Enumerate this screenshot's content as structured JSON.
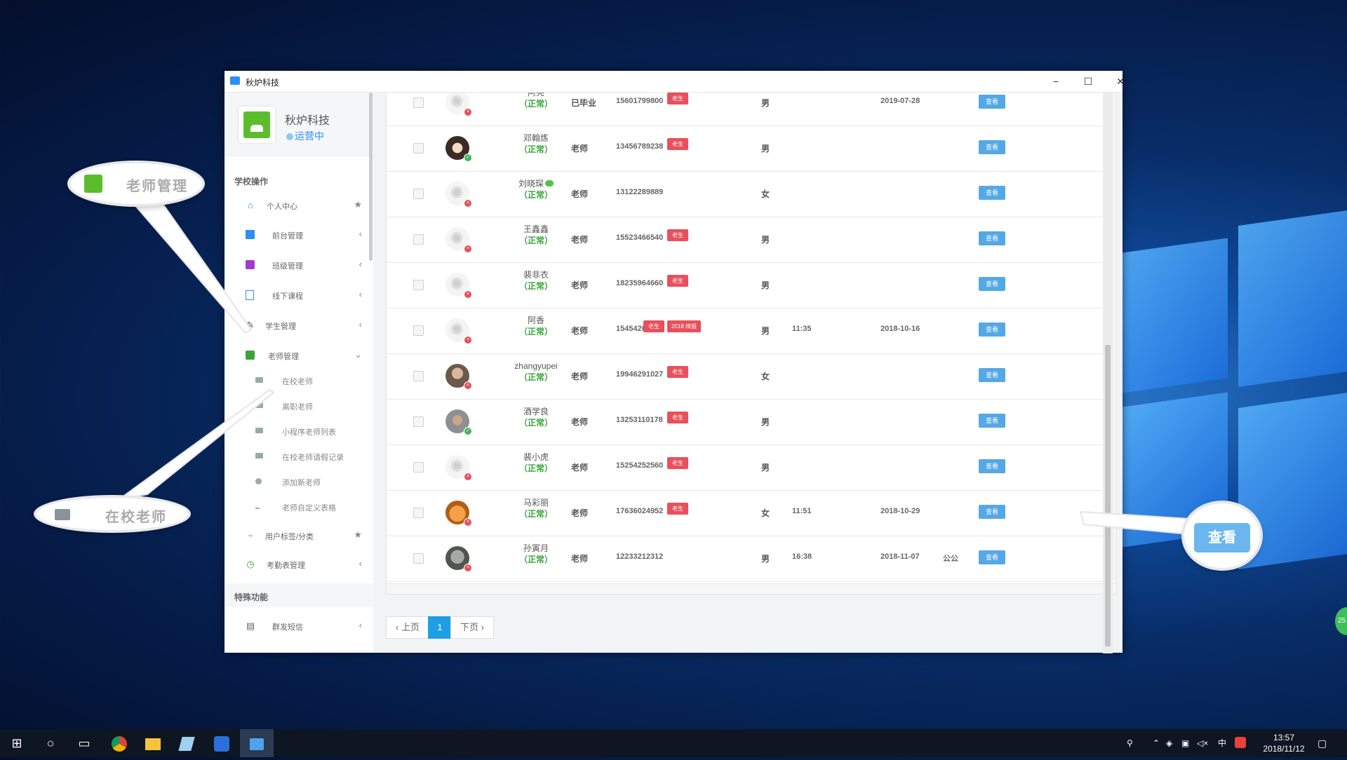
{
  "window": {
    "title": "秋炉科技"
  },
  "brand": {
    "name": "秋炉科技",
    "status": "运营中"
  },
  "sidebar": {
    "section1": "学校操作",
    "items": [
      {
        "label": "个人中心",
        "icon": "home-icon",
        "right": "★"
      },
      {
        "label": "前台管理",
        "icon": "grid-icon",
        "right": "‹"
      },
      {
        "label": "班级管理",
        "icon": "class-icon",
        "right": "‹"
      },
      {
        "label": "线下课程",
        "icon": "doc-icon",
        "right": "‹"
      },
      {
        "label": "学生管理",
        "icon": "student-icon",
        "right": "‹"
      },
      {
        "label": "老师管理",
        "icon": "teacher-icon",
        "right": "⌄"
      }
    ],
    "sub_items": [
      {
        "label": "在校老师"
      },
      {
        "label": "离职老师"
      },
      {
        "label": "小程序老师列表"
      },
      {
        "label": "在校老师请假记录"
      },
      {
        "label": "添加新老师"
      },
      {
        "label": "老师自定义表格"
      }
    ],
    "items2": [
      {
        "label": "用户标签/分类",
        "right": "★"
      },
      {
        "label": "考勤表管理",
        "right": "‹"
      }
    ],
    "section2": "特殊功能",
    "items3": [
      {
        "label": "群发短信",
        "right": "‹"
      }
    ]
  },
  "table": {
    "view_label": "查看",
    "rows": [
      {
        "name": "阿亮",
        "status": "（正常）",
        "role": "已毕业",
        "phone": "15601799800",
        "tags": [
          "老生"
        ],
        "gender": "男",
        "time": "",
        "date": "2019-07-28",
        "extra": "",
        "avatar": "gear",
        "dot": "bad"
      },
      {
        "name": "邓翰炼",
        "status": "（正常）",
        "role": "老师",
        "phone": "13456789238",
        "tags": [
          "老生"
        ],
        "gender": "男",
        "time": "",
        "date": "",
        "extra": "",
        "avatar": "kid",
        "dot": "ok"
      },
      {
        "name": "刘晓琛",
        "status": "（正常）",
        "role": "老师",
        "phone": "13122289889",
        "tags": [],
        "gender": "女",
        "time": "",
        "date": "",
        "extra": "",
        "avatar": "gear",
        "dot": "bad",
        "wechat": true
      },
      {
        "name": "王鑫鑫",
        "status": "（正常）",
        "role": "老师",
        "phone": "15523466540",
        "tags": [
          "老生"
        ],
        "gender": "男",
        "time": "",
        "date": "",
        "extra": "",
        "avatar": "gear",
        "dot": "bad"
      },
      {
        "name": "裴非衣",
        "status": "（正常）",
        "role": "老师",
        "phone": "18235964660",
        "tags": [
          "老生"
        ],
        "gender": "男",
        "time": "",
        "date": "",
        "extra": "",
        "avatar": "gear",
        "dot": "bad"
      },
      {
        "name": "阿香",
        "status": "（正常）",
        "role": "老师",
        "phone": "15454263950",
        "tags": [
          "老生",
          "2018 续报"
        ],
        "gender": "男",
        "time": "11:35",
        "date": "2018-10-16",
        "extra": "",
        "avatar": "gear",
        "dot": "bad"
      },
      {
        "name": "zhangyupei",
        "status": "（正常）",
        "role": "老师",
        "phone": "19946291027",
        "tags": [
          "老生"
        ],
        "gender": "女",
        "time": "",
        "date": "",
        "extra": "",
        "avatar": "photo",
        "dot": "bad"
      },
      {
        "name": "酒学良",
        "status": "（正常）",
        "role": "老师",
        "phone": "13253110178",
        "tags": [
          "老生"
        ],
        "gender": "男",
        "time": "",
        "date": "",
        "extra": "",
        "avatar": "photo2",
        "dot": "ok"
      },
      {
        "name": "裴小虎",
        "status": "（正常）",
        "role": "老师",
        "phone": "15254252560",
        "tags": [
          "老生"
        ],
        "gender": "男",
        "time": "",
        "date": "",
        "extra": "",
        "avatar": "gear",
        "dot": "bad"
      },
      {
        "name": "马彩丽",
        "status": "（正常）",
        "role": "老师",
        "phone": "17636024952",
        "tags": [
          "老生"
        ],
        "gender": "女",
        "time": "11:51",
        "date": "2018-10-29",
        "extra": "",
        "avatar": "cat",
        "dot": "bad"
      },
      {
        "name": "孙寅月",
        "status": "（正常）",
        "role": "老师",
        "phone": "12233212312",
        "tags": [],
        "gender": "男",
        "time": "16:38",
        "date": "2018-11-07",
        "extra": "公公",
        "avatar": "gray",
        "dot": "bad"
      }
    ]
  },
  "pager": {
    "prev": "‹ 上页",
    "current": "1",
    "next": "下页 ›"
  },
  "callouts": {
    "teacher_mgmt": "老师管理",
    "in_school": "在校老师",
    "view": "查看"
  },
  "taskbar": {
    "time": "13:57",
    "date": "2018/11/12",
    "ime": "中",
    "bubble": "25"
  }
}
